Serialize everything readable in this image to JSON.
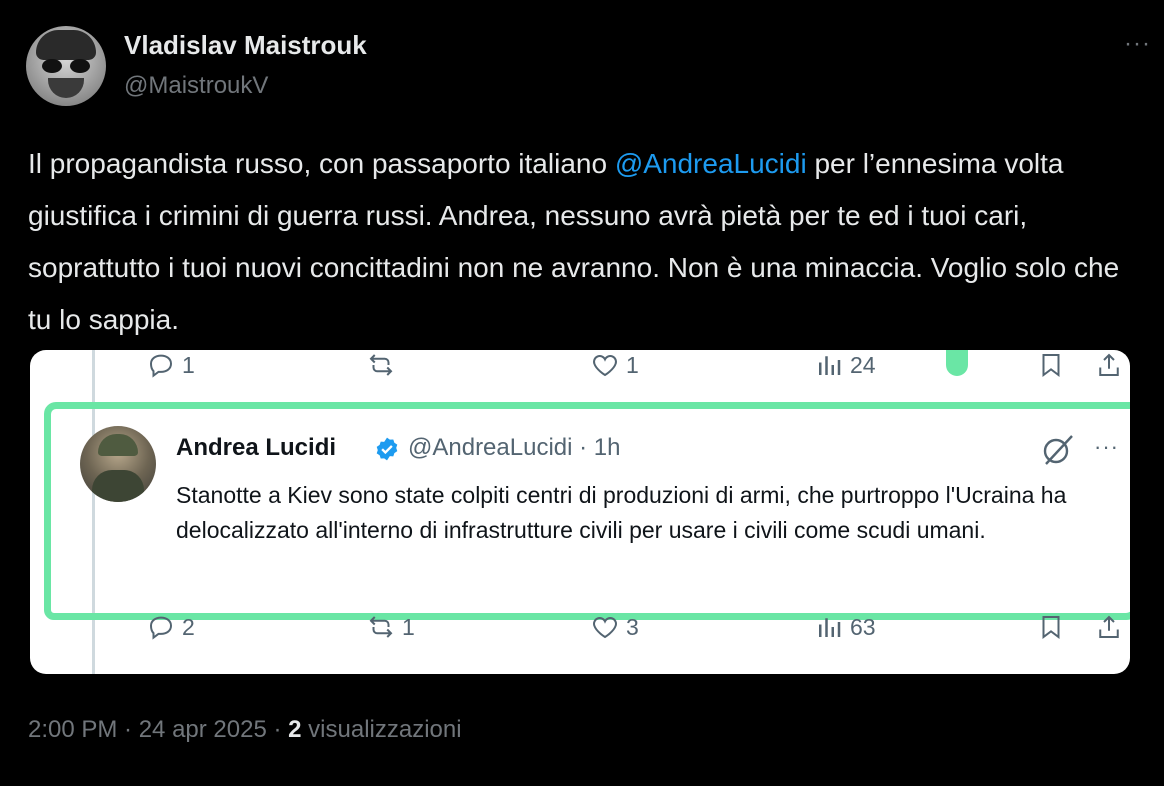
{
  "author": {
    "name": "Vladislav Maistrouk",
    "handle": "@MaistroukV",
    "avatar_icon": "profile-photo"
  },
  "more_icon": "ellipsis-icon",
  "post": {
    "text_before": "Il propagandista russo, con passaporto italiano ",
    "mention": "@AndreaLucidi",
    "text_after": " per l’ennesima volta giustifica i crimini di guerra russi. Andrea, nessuno avrà pietà per te ed i tuoi cari, soprattutto i tuoi nuovi concittadini non ne avranno. Non è una minaccia. Voglio solo che tu lo sappia.",
    "mention_color": "#1d9bf0"
  },
  "screenshot": {
    "top_actions": {
      "replies": "1",
      "likes": "1",
      "views": "24"
    },
    "quoted": {
      "name": "Andrea Lucidi",
      "handle_time": "@AndreaLucidi · 1h",
      "text": "Stanotte a Kiev sono state colpiti centri di produzioni di armi, che purtroppo l'Ucraina ha delocalizzato all'interno di infrastrutture civili per usare i civili come scudi umani."
    },
    "bottom_actions": {
      "replies": "2",
      "reposts": "1",
      "likes": "3",
      "views": "63"
    },
    "highlight_color": "#6ae6a5"
  },
  "meta": {
    "time_date": "2:00 PM · 24 apr 2025 · ",
    "views_count": "2",
    "views_label": " visualizzazioni"
  }
}
